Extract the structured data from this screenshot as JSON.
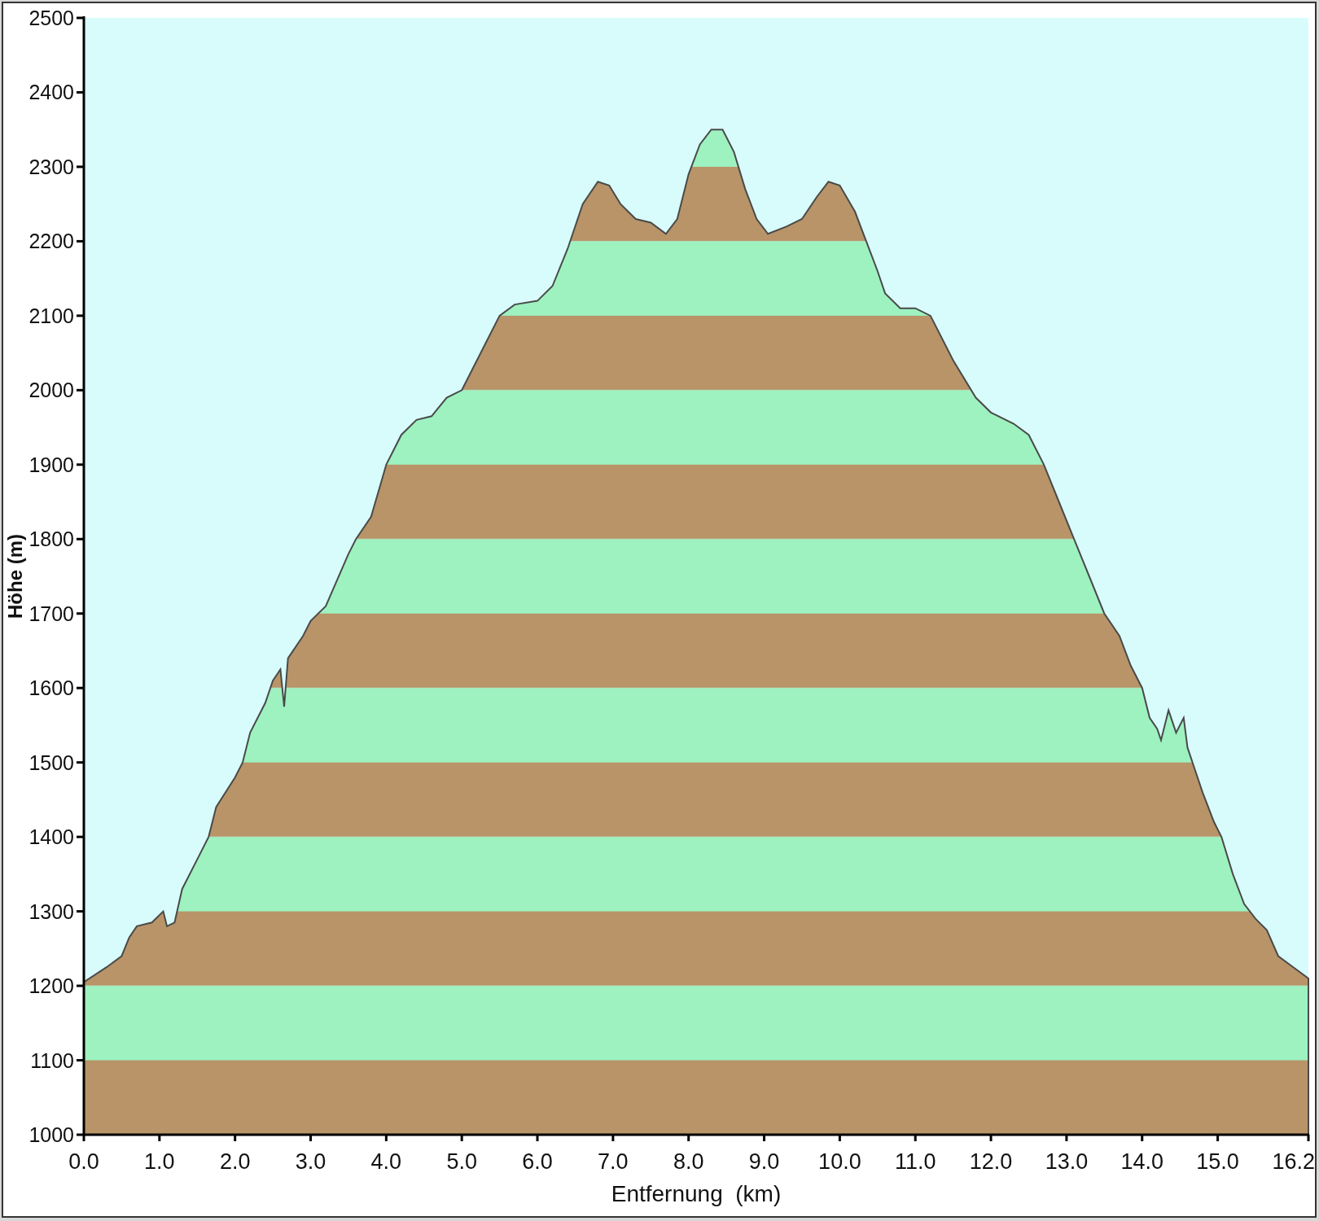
{
  "chart": {
    "chart_data": {
      "type": "area",
      "xlabel": "Entfernung  (km)",
      "ylabel": "Höhe (m)",
      "x": [
        0.0,
        0.3,
        0.5,
        0.6,
        0.7,
        0.9,
        1.05,
        1.1,
        1.2,
        1.3,
        1.5,
        1.65,
        1.75,
        2.0,
        2.1,
        2.2,
        2.4,
        2.5,
        2.6,
        2.65,
        2.7,
        2.9,
        3.0,
        3.2,
        3.5,
        3.6,
        3.8,
        4.0,
        4.2,
        4.4,
        4.6,
        4.8,
        5.0,
        5.3,
        5.5,
        5.7,
        6.0,
        6.2,
        6.4,
        6.6,
        6.8,
        6.95,
        7.1,
        7.3,
        7.5,
        7.7,
        7.85,
        8.0,
        8.15,
        8.3,
        8.45,
        8.6,
        8.75,
        8.9,
        9.05,
        9.3,
        9.5,
        9.7,
        9.85,
        10.0,
        10.2,
        10.35,
        10.5,
        10.6,
        10.8,
        11.0,
        11.2,
        11.5,
        11.8,
        12.0,
        12.3,
        12.5,
        12.7,
        12.9,
        13.1,
        13.3,
        13.5,
        13.7,
        13.85,
        14.0,
        14.1,
        14.2,
        14.25,
        14.35,
        14.45,
        14.55,
        14.6,
        14.7,
        14.8,
        14.95,
        15.05,
        15.2,
        15.35,
        15.5,
        15.65,
        15.8,
        16.0,
        16.2
      ],
      "values": [
        1205,
        1225,
        1240,
        1265,
        1280,
        1285,
        1300,
        1280,
        1285,
        1330,
        1370,
        1400,
        1440,
        1480,
        1500,
        1540,
        1580,
        1610,
        1625,
        1575,
        1640,
        1670,
        1690,
        1710,
        1780,
        1800,
        1830,
        1900,
        1940,
        1960,
        1965,
        1990,
        2000,
        2060,
        2100,
        2115,
        2120,
        2140,
        2190,
        2250,
        2280,
        2275,
        2250,
        2230,
        2225,
        2210,
        2230,
        2290,
        2330,
        2350,
        2350,
        2320,
        2270,
        2230,
        2210,
        2220,
        2230,
        2260,
        2280,
        2275,
        2240,
        2200,
        2160,
        2130,
        2110,
        2110,
        2100,
        2040,
        1990,
        1970,
        1955,
        1940,
        1900,
        1850,
        1800,
        1750,
        1700,
        1670,
        1630,
        1600,
        1560,
        1545,
        1530,
        1570,
        1540,
        1560,
        1520,
        1490,
        1460,
        1420,
        1400,
        1350,
        1310,
        1290,
        1275,
        1240,
        1225,
        1210
      ],
      "xlim": [
        0,
        16.2
      ],
      "ylim": [
        1000,
        2500
      ],
      "xticks": [
        {
          "value": 0,
          "label": "0.0"
        },
        {
          "value": 1,
          "label": "1.0"
        },
        {
          "value": 2,
          "label": "2.0"
        },
        {
          "value": 3,
          "label": "3.0"
        },
        {
          "value": 4,
          "label": "4.0"
        },
        {
          "value": 5,
          "label": "5.0"
        },
        {
          "value": 6,
          "label": "6.0"
        },
        {
          "value": 7,
          "label": "7.0"
        },
        {
          "value": 8,
          "label": "8.0"
        },
        {
          "value": 9,
          "label": "9.0"
        },
        {
          "value": 10,
          "label": "10.0"
        },
        {
          "value": 11,
          "label": "11.0"
        },
        {
          "value": 12,
          "label": "12.0"
        },
        {
          "value": 13,
          "label": "13.0"
        },
        {
          "value": 14,
          "label": "14.0"
        },
        {
          "value": 15,
          "label": "15.0"
        },
        {
          "value": 16.2,
          "label": "16.2"
        }
      ],
      "yticks": [
        1000,
        1100,
        1200,
        1300,
        1400,
        1500,
        1600,
        1700,
        1800,
        1900,
        2000,
        2100,
        2200,
        2300,
        2400,
        2500
      ]
    }
  }
}
